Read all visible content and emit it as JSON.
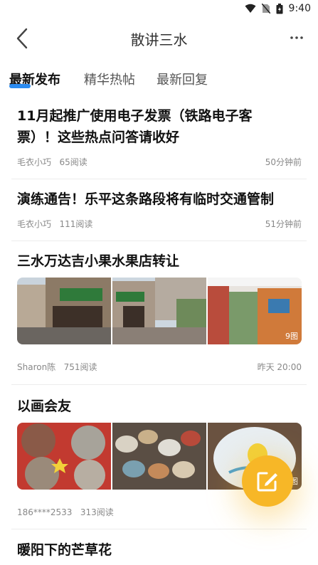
{
  "status_bar": {
    "time": "9:40"
  },
  "header": {
    "title": "散讲三水",
    "back_icon": "chevron-left-icon",
    "more_icon": "more-icon"
  },
  "tabs": [
    {
      "label": "最新发布",
      "active": true
    },
    {
      "label": "精华热帖",
      "active": false
    },
    {
      "label": "最新回复",
      "active": false
    }
  ],
  "posts": [
    {
      "title_line1": "11月起推广使用电子发票（铁路电子客",
      "title_line2": "票）！这些热点问答请收好",
      "author": "毛衣小巧",
      "reads": "65阅读",
      "time": "50分钟前"
    },
    {
      "title": "演练通告！乐平这条路段将有临时交通管制",
      "author": "毛衣小巧",
      "reads": "111阅读",
      "time": "51分钟前"
    },
    {
      "title": "三水万达吉小果水果店转让",
      "author": "Sharon陈",
      "reads": "751阅读",
      "time": "昨天 20:00",
      "image_count": "9图"
    },
    {
      "title": "以画会友",
      "author": "186****2533",
      "reads": "313阅读",
      "image_count": "4图"
    },
    {
      "title": "暖阳下的芒草花"
    }
  ],
  "colors": {
    "accent": "#2b8bf0",
    "fab": "#f7b727"
  },
  "fab": {
    "icon": "edit-icon"
  }
}
